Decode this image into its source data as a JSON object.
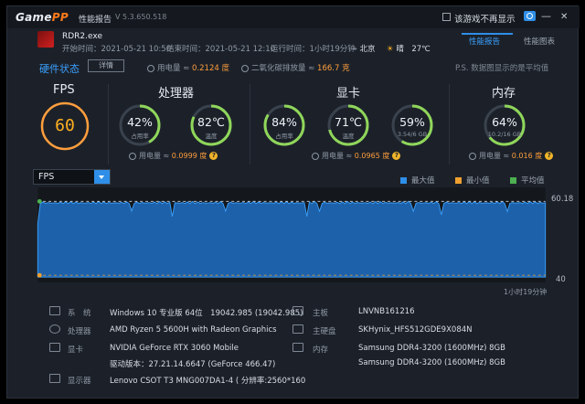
{
  "titlebar": {
    "logo_a": "Game",
    "logo_b": "PP",
    "app_title": "性能报告",
    "version": "V 5.3.650.518",
    "hide_label": "该游戏不再显示",
    "minimize": "—",
    "close": "✕"
  },
  "session": {
    "game": "RDR2.exe",
    "start_label": "开始时间：",
    "start": "2021-05-21 10:50",
    "end_label": "结束时间：",
    "end": "2021-05-21 12:10",
    "duration_label": "运行时间：",
    "duration": "1小时19分钟",
    "location": "北京",
    "weather": "晴",
    "temperature": "27℃"
  },
  "tabs": [
    {
      "label": "性能报告"
    },
    {
      "label": "性能图表"
    }
  ],
  "hw": {
    "title": "硬件状态",
    "detail_button": "详情",
    "power_label": "用电量 ≈",
    "power_total": "0.2124 度",
    "co2_label": "二氧化碳排放量 ≈",
    "co2": "166.7 克",
    "note": "P.S. 数据图显示的是平均值"
  },
  "fps": {
    "title": "FPS",
    "value": "60"
  },
  "cpu": {
    "title": "处理器",
    "usage": "42%",
    "usage_label": "占用率",
    "usage_pct": 42,
    "temp": "82℃",
    "temp_label": "温度",
    "temp_pct": 82,
    "power_label": "用电量 ≈",
    "power": "0.0999 度"
  },
  "gpu": {
    "title": "显卡",
    "usage": "84%",
    "usage_label": "占用率",
    "usage_pct": 84,
    "temp": "71℃",
    "temp_label": "温度",
    "temp_pct": 71,
    "vram": "59%",
    "vram_label": "3.54/6 GB",
    "vram_pct": 59,
    "power_label": "用电量 ≈",
    "power": "0.0965 度"
  },
  "memory": {
    "title": "内存",
    "usage": "64%",
    "usage_label": "10.2/16 GB",
    "usage_pct": 64,
    "power_label": "用电量 ≈",
    "power": "0.016 度"
  },
  "chart_controls": {
    "metric": "FPS",
    "legend": [
      {
        "label": "最大值",
        "color": "#2f8fe8"
      },
      {
        "label": "最小值",
        "color": "#f0a030"
      },
      {
        "label": "平均值",
        "color": "#4caf50"
      }
    ]
  },
  "chart_data": {
    "type": "area",
    "series": [
      {
        "name": "最大值",
        "color": "#2f8fe8"
      },
      {
        "name": "平均值",
        "color": "#4caf50",
        "value": 60.18
      },
      {
        "name": "最小值",
        "color": "#f0a030",
        "value": 40
      }
    ],
    "annotations": [
      "60.18",
      "40"
    ],
    "ylim": [
      40,
      62
    ],
    "x_label": "1小时19分钟",
    "grid": false
  },
  "system": {
    "os_label": "系　统",
    "os": "Windows 10 专业版 64位　19042.985 (19042.985)",
    "cpu_label": "处理器",
    "cpu": "AMD Ryzen 5 5600H with Radeon Graphics",
    "gpu_label": "显卡",
    "gpu": "NVIDIA GeForce RTX 3060 Mobile",
    "driver": "驱动版本：27.21.14.6647 (GeForce 466.47)",
    "display_label": "显示器",
    "display": "Lenovo CSOT T3 MNG007DA1-4 ( 分辨率:2560*160",
    "board_label": "主板",
    "board": "LNVNB161216",
    "disk_label": "主硬盘",
    "disk": "SKHynix_HFS512GDE9X084N",
    "mem_label": "内存",
    "mem1": "Samsung DDR4-3200 (1600MHz) 8GB",
    "mem2": "Samsung DDR4-3200 (1600MHz) 8GB"
  }
}
